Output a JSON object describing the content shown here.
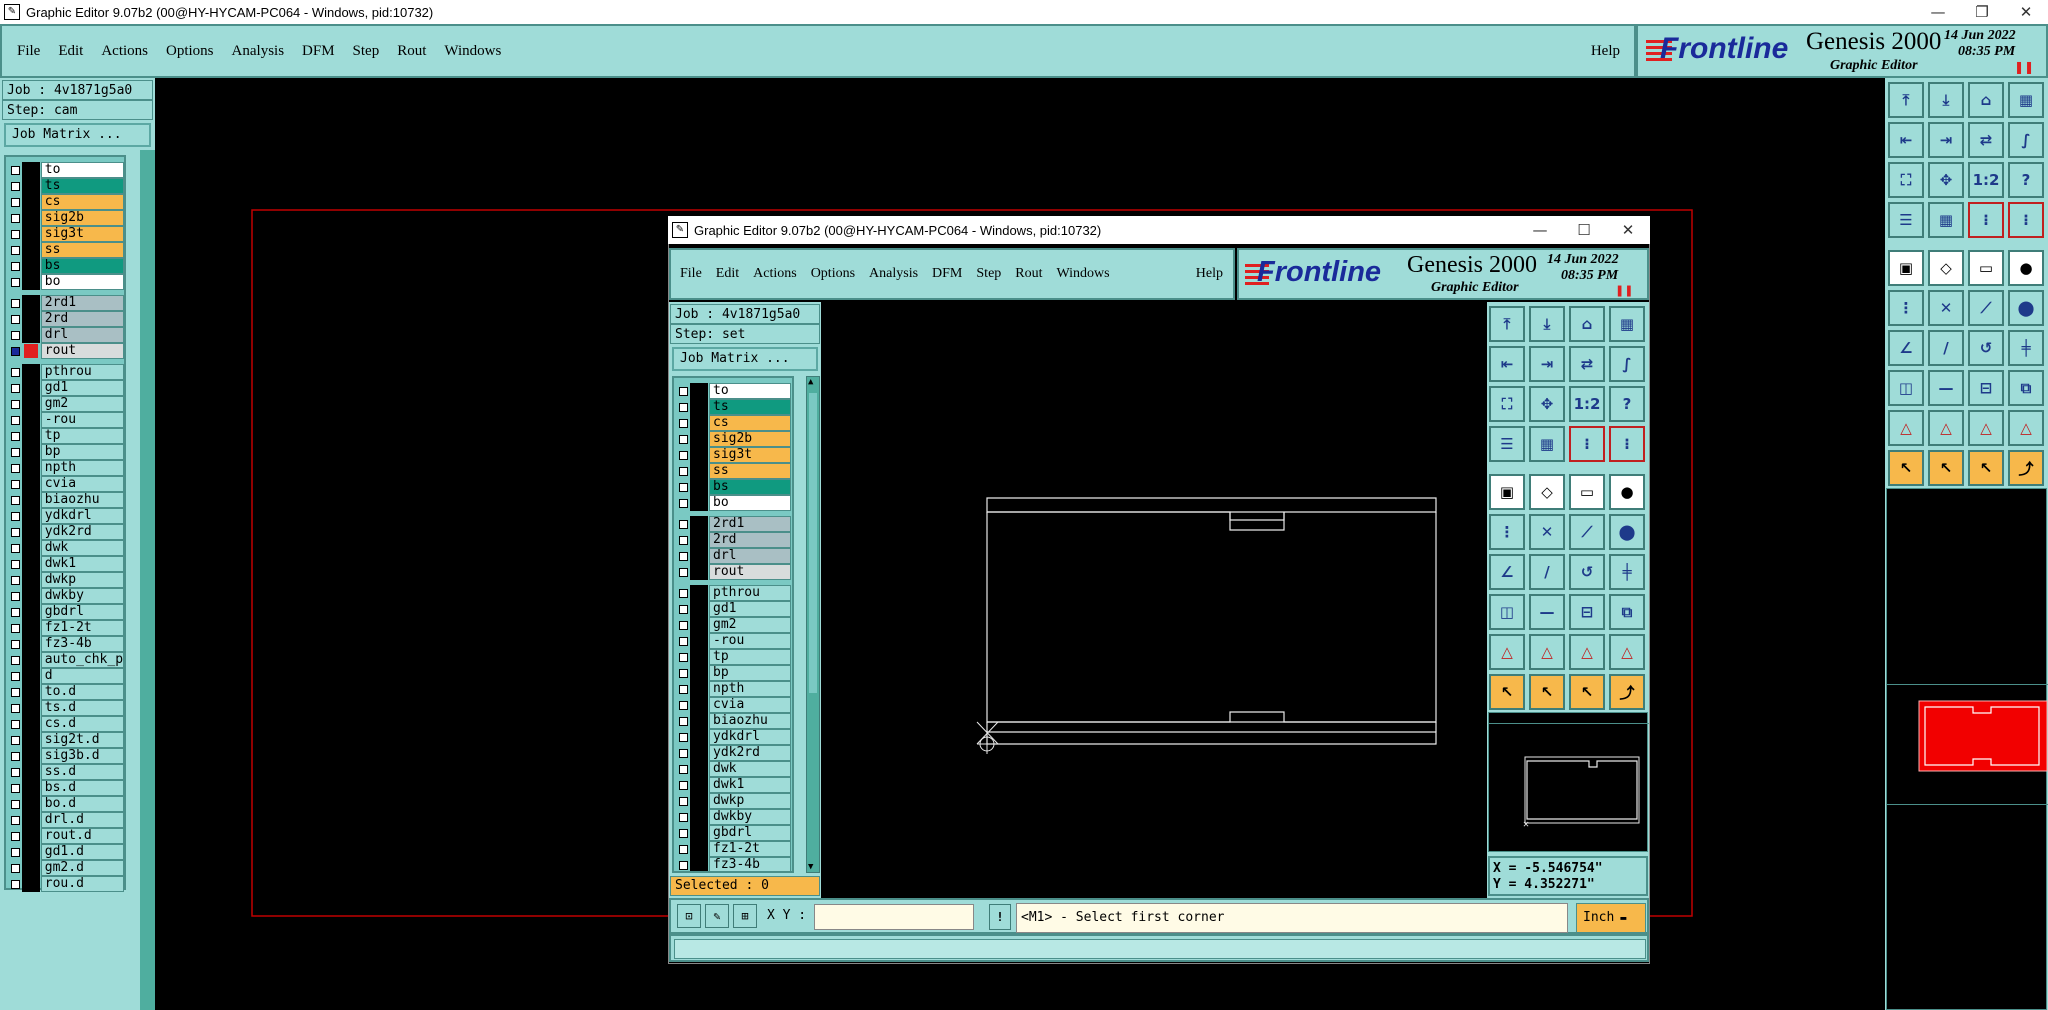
{
  "outer": {
    "title": "Graphic Editor 9.07b2 (00@HY-HYCAM-PC064 - Windows, pid:10732)",
    "menu": [
      "File",
      "Edit",
      "Actions",
      "Options",
      "Analysis",
      "DFM",
      "Step",
      "Rout",
      "Windows"
    ],
    "help": "Help",
    "brand": {
      "logo": "Frontline",
      "product": "Genesis 2000",
      "subtitle": "Graphic Editor",
      "date": "14 Jun 2022",
      "time": "08:35 PM"
    },
    "job": "Job : 4v1871g5a0",
    "step": "Step: cam",
    "job_matrix": "Job Matrix ...",
    "layers_group1": [
      "to",
      "ts",
      "cs",
      "sig2b",
      "sig3t",
      "ss",
      "bs",
      "bo"
    ],
    "layers_group2": [
      "2rd1",
      "2rd",
      "drl",
      "rout"
    ],
    "layers_group3": [
      "pthrou",
      "gd1",
      "gm2",
      "-rou",
      "tp",
      "bp",
      "npth",
      "cvia",
      "biaozhu",
      "ydkdrl",
      "ydk2rd",
      "dwk",
      "dwk1",
      "dwkp",
      "dwkby",
      "gbdrl",
      "fz1-2t",
      "fz3-4b",
      "auto_chk_pn",
      "d",
      "to.d",
      "ts.d",
      "cs.d",
      "sig2t.d",
      "sig3b.d",
      "ss.d",
      "bs.d",
      "bo.d",
      "drl.d",
      "rout.d",
      "gd1.d",
      "gm2.d",
      "rou.d"
    ]
  },
  "inner": {
    "title": "Graphic Editor 9.07b2 (00@HY-HYCAM-PC064 - Windows, pid:10732)",
    "menu": [
      "File",
      "Edit",
      "Actions",
      "Options",
      "Analysis",
      "DFM",
      "Step",
      "Rout",
      "Windows"
    ],
    "help": "Help",
    "brand": {
      "logo": "Frontline",
      "product": "Genesis 2000",
      "subtitle": "Graphic Editor",
      "date": "14 Jun 2022",
      "time": "08:35 PM"
    },
    "job": "Job : 4v1871g5a0",
    "step": "Step: set",
    "job_matrix": "Job Matrix ...",
    "layers_group1": [
      "to",
      "ts",
      "cs",
      "sig2b",
      "sig3t",
      "ss",
      "bs",
      "bo"
    ],
    "layers_group2": [
      "2rd1",
      "2rd",
      "drl",
      "rout"
    ],
    "layers_group3": [
      "pthrou",
      "gd1",
      "gm2",
      "-rou",
      "tp",
      "bp",
      "npth",
      "cvia",
      "biaozhu",
      "ydkdrl",
      "ydk2rd",
      "dwk",
      "dwk1",
      "dwkp",
      "dwkby",
      "gbdrl",
      "fz1-2t",
      "fz3-4b"
    ],
    "selected": "Selected : 0",
    "coord_x": "X = -5.546754\"",
    "coord_y": "Y = 4.352271\"",
    "xy_label": "X Y :",
    "xy_value": "",
    "prompt": "<M1> - Select first corner",
    "unit": "Inch"
  },
  "toolbar_rows": [
    [
      "open-step",
      "save",
      "home",
      "panes"
    ],
    [
      "import",
      "export",
      "undo-redo",
      "snap"
    ],
    [
      "fit",
      "zoom",
      "one-to-two",
      "help"
    ],
    [
      "display",
      "grid",
      "traffic-light",
      "traffic-light"
    ],
    [
      "measure",
      "draw",
      "ruler",
      "dot"
    ],
    [
      "select",
      "move",
      "connect",
      "node"
    ],
    [
      "line",
      "arc-line",
      "arc",
      "split"
    ],
    [
      "pad",
      "cut",
      "center",
      "spot"
    ],
    [
      "triangle",
      "triangle",
      "triangle",
      "triangle"
    ],
    [
      "pointer",
      "pointer",
      "pointer",
      "pointer-route"
    ]
  ],
  "colors": {
    "panel": "#9fdcd8",
    "panel_dark": "#4b8f8a",
    "teal_layer": "#109a80",
    "orange_layer": "#f7b84b",
    "grey_layer": "#a9bfc4",
    "light_layer": "#9fdcd8",
    "white_layer": "#ffffff",
    "rout_outline": "#c00000",
    "brand_blue": "#1a2a9a",
    "pause_red": "#e02020"
  }
}
